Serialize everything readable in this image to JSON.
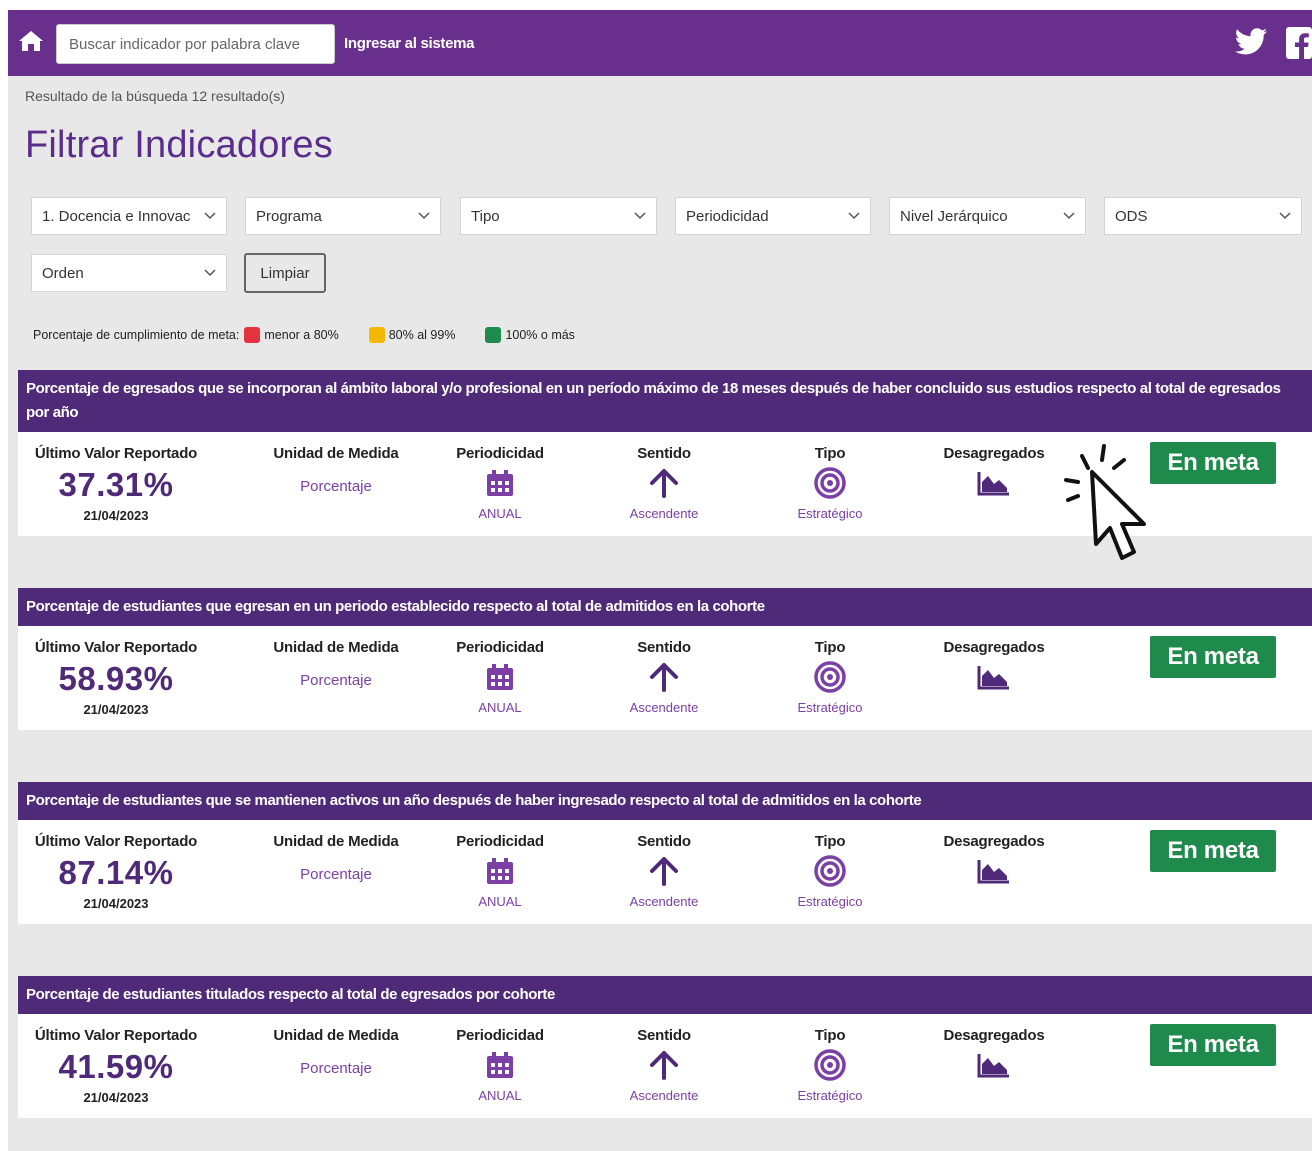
{
  "header": {
    "search_placeholder": "Buscar indicador por palabra clave",
    "login_label": "Ingresar al sistema"
  },
  "search_result_text": "Resultado de la búsqueda 12 resultado(s)",
  "page_title": "Filtrar Indicadores",
  "filters": [
    {
      "label": "1. Docencia e Innovac"
    },
    {
      "label": "Programa"
    },
    {
      "label": "Tipo"
    },
    {
      "label": "Periodicidad"
    },
    {
      "label": "Nivel Jerárquico"
    },
    {
      "label": "ODS"
    },
    {
      "label": "Orden"
    }
  ],
  "clear_label": "Limpiar",
  "legend": {
    "title": "Porcentaje de cumplimiento de meta:",
    "items": [
      {
        "label": "menor a 80%",
        "color": "#e5323f"
      },
      {
        "label": "80% al 99%",
        "color": "#f5b800"
      },
      {
        "label": "100% o más",
        "color": "#1e8a4c"
      }
    ]
  },
  "column_labels": {
    "last_value": "Último Valor Reportado",
    "unit": "Unidad de Medida",
    "periodicity": "Periodicidad",
    "direction": "Sentido",
    "type": "Tipo",
    "disaggregated": "Desagregados"
  },
  "indicators": [
    {
      "title": "Porcentaje de egresados que se incorporan al ámbito laboral y/o profesional en un período máximo de 18 meses después de haber concluido sus estudios respecto al total de egresados por año",
      "value": "37.31%",
      "date": "21/04/2023",
      "unit": "Porcentaje",
      "periodicity": "ANUAL",
      "direction": "Ascendente",
      "type": "Estratégico",
      "status": "En meta"
    },
    {
      "title": "Porcentaje de estudiantes que egresan en un periodo establecido respecto al total de admitidos en la cohorte",
      "value": "58.93%",
      "date": "21/04/2023",
      "unit": "Porcentaje",
      "periodicity": "ANUAL",
      "direction": "Ascendente",
      "type": "Estratégico",
      "status": "En meta"
    },
    {
      "title": "Porcentaje de estudiantes que se mantienen activos un año después de haber ingresado respecto al total de admitidos en la cohorte",
      "value": "87.14%",
      "date": "21/04/2023",
      "unit": "Porcentaje",
      "periodicity": "ANUAL",
      "direction": "Ascendente",
      "type": "Estratégico",
      "status": "En meta"
    },
    {
      "title": "Porcentaje de estudiantes titulados respecto al total de egresados por cohorte",
      "value": "41.59%",
      "date": "21/04/2023",
      "unit": "Porcentaje",
      "periodicity": "ANUAL",
      "direction": "Ascendente",
      "type": "Estratégico",
      "status": "En meta"
    }
  ],
  "icons": {
    "home": "home-icon",
    "twitter": "twitter-icon",
    "facebook": "facebook-icon",
    "periodicity": "calendar-icon",
    "direction": "arrow-up-icon",
    "type": "target-icon",
    "disaggregated": "area-chart-icon",
    "pointer": "hand-pointer-icon"
  },
  "colors": {
    "brand_purple": "#68308c",
    "header_purple": "#4f2a78",
    "accent_purple": "#7b3fa5",
    "success_green": "#1e8a4c"
  }
}
